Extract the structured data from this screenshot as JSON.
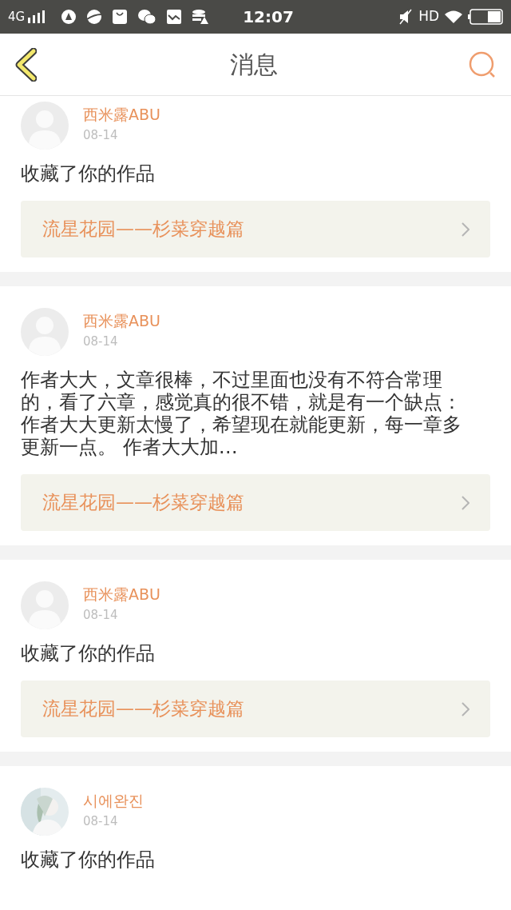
{
  "status_bar": {
    "network": "4G",
    "time": "12:07",
    "quality": "HD"
  },
  "header": {
    "title": "消息"
  },
  "messages": [
    {
      "kind": "default",
      "user": "西米露ABU",
      "date": "08-14",
      "text": "收藏了你的作品",
      "work": "流星花园——杉菜穿越篇"
    },
    {
      "kind": "default",
      "user": "西米露ABU",
      "date": "08-14",
      "text": "作者大大，文章很棒，不过里面也没有不符合常理的，看了六章，感觉真的很不错，就是有一个缺点：作者大大更新太慢了，希望现在就能更新，每一章多更新一点。 作者大大加…",
      "work": "流星花园——杉菜穿越篇"
    },
    {
      "kind": "default",
      "user": "西米露ABU",
      "date": "08-14",
      "text": "收藏了你的作品",
      "work": "流星花园——杉菜穿越篇"
    },
    {
      "user": "시에완진",
      "date": "08-14",
      "text": "收藏了你的作品"
    }
  ]
}
